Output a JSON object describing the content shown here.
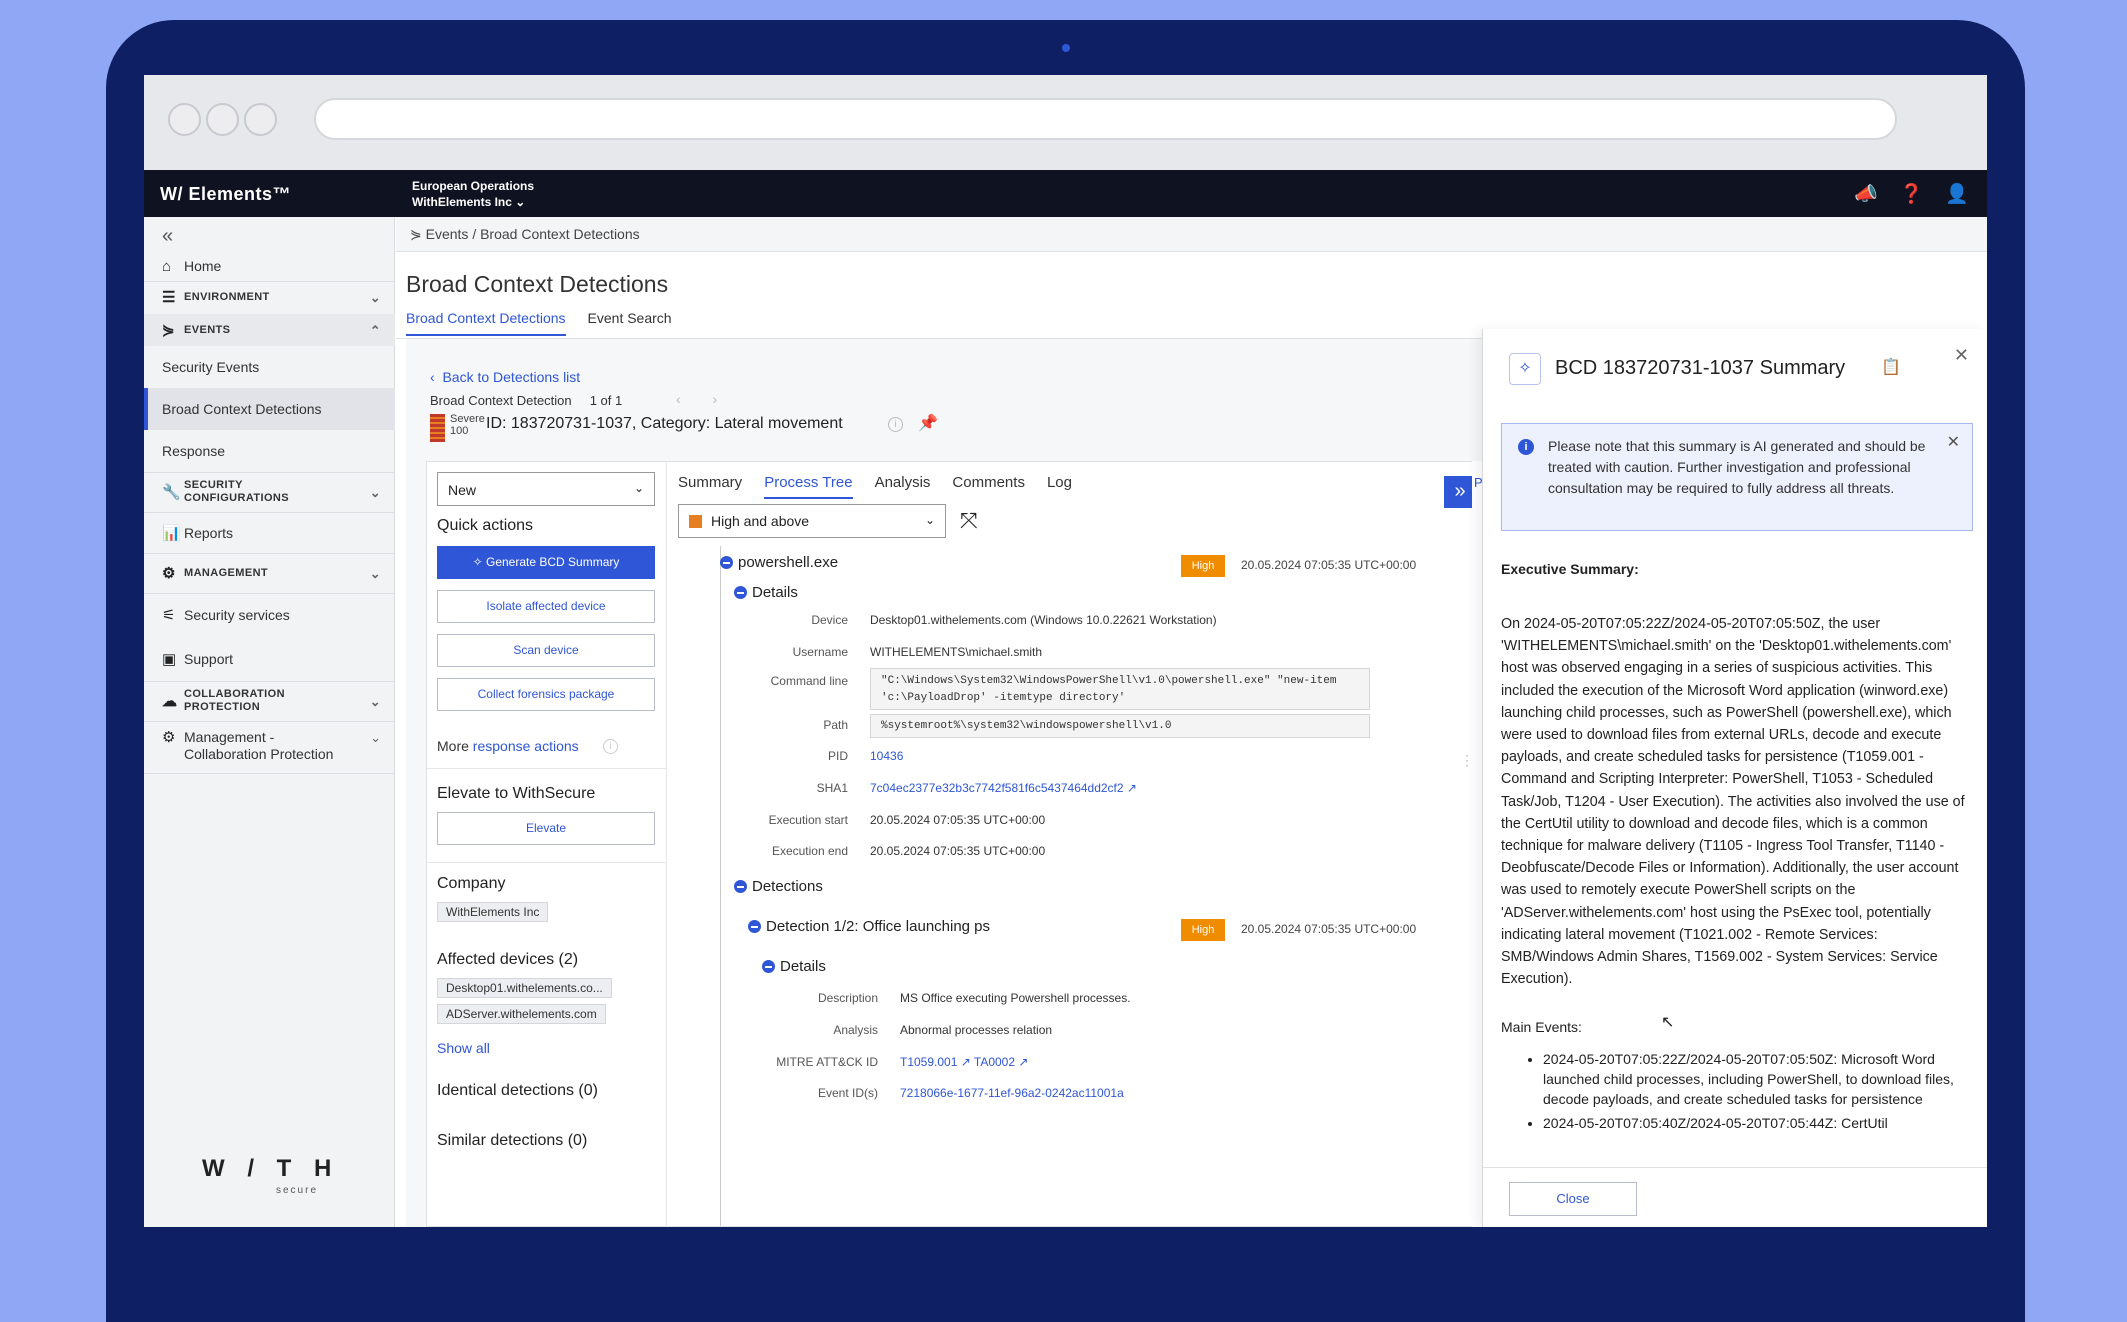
{
  "topbar": {
    "brand": "W/ Elements™",
    "org_line1": "European Operations",
    "org_line2": "WithElements Inc ⌄"
  },
  "sidebar": {
    "items": [
      {
        "label": "Home",
        "icon": "home-icon"
      },
      {
        "label": "ENVIRONMENT",
        "icon": "list-icon"
      },
      {
        "label": "EVENTS",
        "icon": "events-icon"
      },
      {
        "label": "Security Events"
      },
      {
        "label": "Broad Context Detections"
      },
      {
        "label": "Response"
      },
      {
        "label": "SECURITY\nCONFIGURATIONS",
        "icon": "wrench-icon"
      },
      {
        "label": "Reports",
        "icon": "bar-chart-icon"
      },
      {
        "label": "MANAGEMENT",
        "icon": "gear-icon"
      },
      {
        "label": "Security services",
        "icon": "sliders-icon"
      },
      {
        "label": "Support",
        "icon": "support-icon"
      },
      {
        "label": "COLLABORATION\nPROTECTION",
        "icon": "cloud-icon"
      },
      {
        "label": "Management -\nCollaboration Protection",
        "icon": "cloud-gear-icon"
      }
    ],
    "logo": "W / T H",
    "logo_sub": "secure"
  },
  "breadcrumb": "Events / Broad Context Detections",
  "page": {
    "title": "Broad Context Detections",
    "tabs": [
      "Broad Context Detections",
      "Event Search"
    ]
  },
  "detection": {
    "back": "Back to Detections list",
    "label": "Broad Context Detection",
    "count": "1 of 1",
    "pager": "‹ ›",
    "severity_word": "Severe",
    "severity_score": "100",
    "id_line": "ID: 183720731-1037, Category: Lateral movement"
  },
  "left": {
    "status": "New",
    "quick_actions": "Quick actions",
    "buttons": [
      "✧ Generate BCD Summary",
      "Isolate affected device",
      "Scan device",
      "Collect forensics package"
    ],
    "more": "More ",
    "more_link": "response actions",
    "elevate_heading": "Elevate to WithSecure",
    "elevate_button": "Elevate",
    "company_heading": "Company",
    "company": "WithElements Inc",
    "affected_heading": "Affected devices (2)",
    "devices": [
      "Desktop01.withelements.co...",
      "ADServer.withelements.com"
    ],
    "show_all": "Show all",
    "identical": "Identical detections (0)",
    "similar": "Similar detections (0)"
  },
  "middle": {
    "tabs": [
      "Summary",
      "Process Tree",
      "Analysis",
      "Comments",
      "Log"
    ],
    "filter": "High and above",
    "process": "powershell.exe",
    "process_badge": "High",
    "process_time": "20.05.2024 07:05:35 UTC+00:00",
    "details": "Details",
    "fields": {
      "device_k": "Device",
      "device_v": "Desktop01.withelements.com (Windows 10.0.22621 Workstation)",
      "user_k": "Username",
      "user_v": "WITHELEMENTS\\michael.smith",
      "cmd_k": "Command line",
      "cmd_v1": "\"C:\\Windows\\System32\\WindowsPowerShell\\v1.0\\powershell.exe\" \"new-item",
      "cmd_v2": "'c:\\PayloadDrop' -itemtype directory'",
      "path_k": "Path",
      "path_v": "%systemroot%\\system32\\windowspowershell\\v1.0",
      "pid_k": "PID",
      "pid_v": "10436",
      "sha_k": "SHA1",
      "sha_v": "7c04ec2377e32b3c7742f581f6c5437464dd2cf2 ↗",
      "start_k": "Execution start",
      "start_v": "20.05.2024 07:05:35 UTC+00:00",
      "end_k": "Execution end",
      "end_v": "20.05.2024 07:05:35 UTC+00:00"
    },
    "detections": "Detections",
    "detection1": "Detection 1/2: Office launching ps",
    "detection1_badge": "High",
    "detection1_time": "20.05.2024 07:05:35 UTC+00:00",
    "d_details": "Details",
    "dfields": {
      "desc_k": "Description",
      "desc_v": "MS Office executing Powershell processes.",
      "an_k": "Analysis",
      "an_v": "Abnormal processes relation",
      "mitre_k": "MITRE ATT&CK ID",
      "mitre_v": "T1059.001 ↗  TA0002 ↗",
      "ev_k": "Event ID(s)",
      "ev_v": "7218066e-1677-11ef-96a2-0242ac11001a"
    },
    "behind_tab": "Pro"
  },
  "panel": {
    "title": "BCD 183720731-1037 Summary",
    "note": "Please note that this summary is AI generated and should be treated with caution. Further investigation and professional consultation may be required to fully address all threats.",
    "exec_heading": "Executive Summary:",
    "exec_text": "On 2024-05-20T07:05:22Z/2024-05-20T07:05:50Z, the user 'WITHELEMENTS\\michael.smith' on the 'Desktop01.withelements.com' host was observed engaging in a series of suspicious activities. This included the execution of the Microsoft Word application (winword.exe) launching child processes, such as PowerShell (powershell.exe), which were used to download files from external URLs, decode and execute payloads, and create scheduled tasks for persistence (T1059.001 - Command and Scripting Interpreter: PowerShell, T1053 - Scheduled Task/Job, T1204 - User Execution). The activities also involved the use of the CertUtil utility to download and decode files, which is a common technique for malware delivery (T1105 - Ingress Tool Transfer, T1140 - Deobfuscate/Decode Files or Information). Additionally, the user account was used to remotely execute PowerShell scripts on the 'ADServer.withelements.com' host using the PsExec tool, potentially indicating lateral movement (T1021.002 - Remote Services: SMB/Windows Admin Shares, T1569.002 - System Services: Service Execution).",
    "events_heading": "Main Events:",
    "events": [
      "2024-05-20T07:05:22Z/2024-05-20T07:05:50Z: Microsoft Word launched child processes, including PowerShell, to download files, decode payloads, and create scheduled tasks for persistence",
      "2024-05-20T07:05:40Z/2024-05-20T07:05:44Z: CertUtil"
    ],
    "close": "Close"
  }
}
